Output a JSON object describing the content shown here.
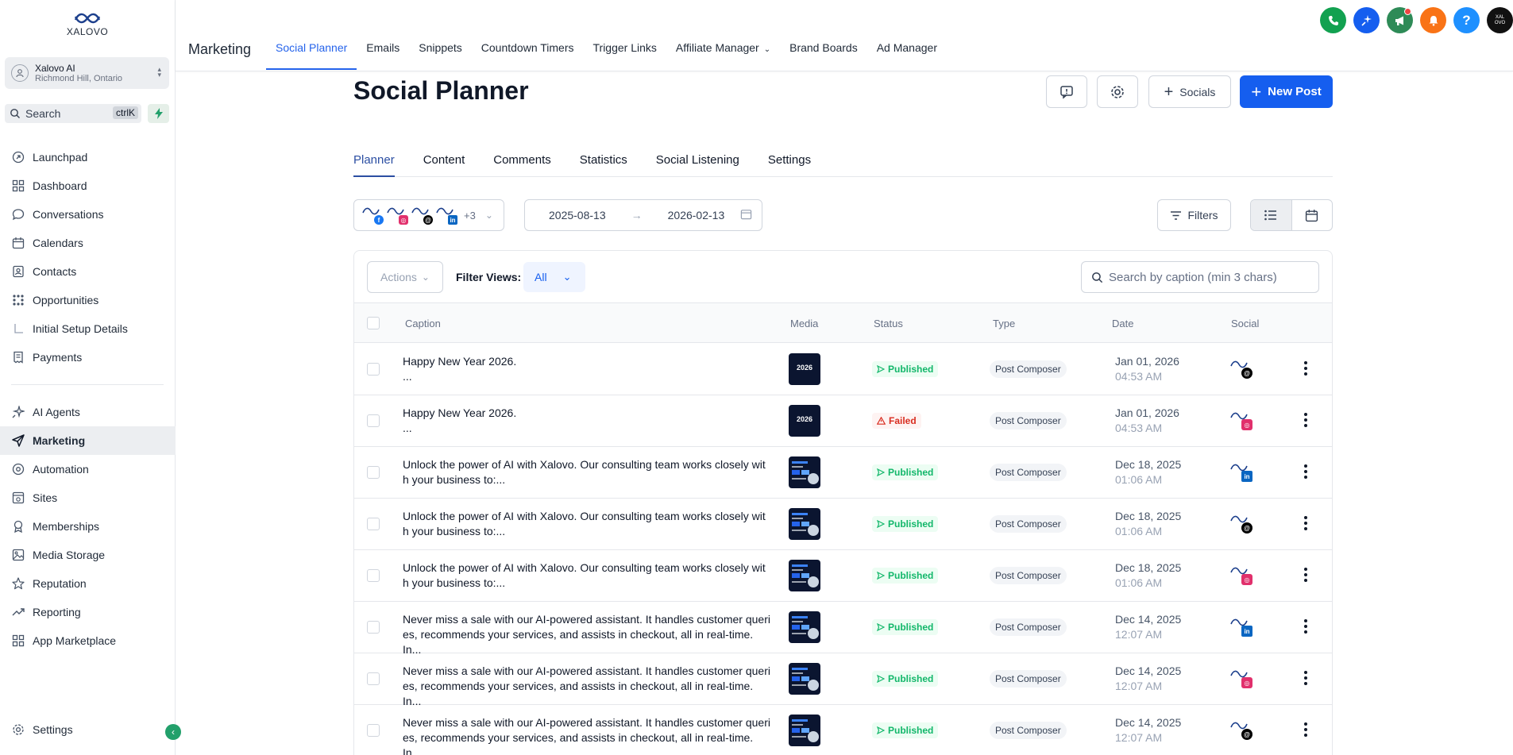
{
  "brand": {
    "logo_text": "XALOVO"
  },
  "account": {
    "name": "Xalovo AI",
    "location": "Richmond Hill, Ontario"
  },
  "search": {
    "label": "Search",
    "shortcut": "ctrlK"
  },
  "sidebar": {
    "items": [
      {
        "label": "Launchpad",
        "icon": "rocket-icon"
      },
      {
        "label": "Dashboard",
        "icon": "grid-icon"
      },
      {
        "label": "Conversations",
        "icon": "chat-icon"
      },
      {
        "label": "Calendars",
        "icon": "calendar-icon"
      },
      {
        "label": "Contacts",
        "icon": "contacts-icon"
      },
      {
        "label": "Opportunities",
        "icon": "funnel-icon"
      },
      {
        "label": "Initial Setup Details",
        "icon": "setup-icon"
      },
      {
        "label": "Payments",
        "icon": "receipt-icon"
      },
      {
        "label": "AI Agents",
        "icon": "sparkle-icon"
      },
      {
        "label": "Marketing",
        "icon": "send-icon"
      },
      {
        "label": "Automation",
        "icon": "automation-icon"
      },
      {
        "label": "Sites",
        "icon": "sites-icon"
      },
      {
        "label": "Memberships",
        "icon": "badge-icon"
      },
      {
        "label": "Media Storage",
        "icon": "image-icon"
      },
      {
        "label": "Reputation",
        "icon": "star-icon"
      },
      {
        "label": "Reporting",
        "icon": "trend-icon"
      },
      {
        "label": "App Marketplace",
        "icon": "apps-icon"
      }
    ],
    "settings_label": "Settings"
  },
  "topnav": {
    "title": "Marketing",
    "tabs": [
      "Social Planner",
      "Emails",
      "Snippets",
      "Countdown Timers",
      "Trigger Links",
      "Affiliate Manager",
      "Brand Boards",
      "Ad Manager"
    ]
  },
  "page": {
    "title": "Social Planner",
    "socials_label": "Socials",
    "new_post_label": "New Post",
    "subtabs": [
      "Planner",
      "Content",
      "Comments",
      "Statistics",
      "Social Listening",
      "Settings"
    ],
    "accounts_more": "+3",
    "date_from": "2025-08-13",
    "date_to": "2026-02-13",
    "filters_label": "Filters"
  },
  "table": {
    "actions_label": "Actions",
    "filter_views_label": "Filter Views:",
    "filter_views_value": "All",
    "search_placeholder": "Search by caption (min 3 chars)",
    "columns": [
      "Caption",
      "Media",
      "Status",
      "Type",
      "Date",
      "Social"
    ],
    "rows": [
      {
        "caption": "Happy New Year 2026.",
        "caption2": "...",
        "media": "2026",
        "status": "Published",
        "type": "Post Composer",
        "date": "Jan 01, 2026",
        "time": "04:53 AM",
        "social": "threads"
      },
      {
        "caption": "Happy New Year 2026.",
        "caption2": "...",
        "media": "2026",
        "status": "Failed",
        "type": "Post Composer",
        "date": "Jan 01, 2026",
        "time": "04:53 AM",
        "social": "instagram"
      },
      {
        "caption": "Unlock the power of AI with Xalovo. Our consulting team works closely wit",
        "caption2": "h your business to:...",
        "media": "",
        "status": "Published",
        "type": "Post Composer",
        "date": "Dec 18, 2025",
        "time": "01:06 AM",
        "social": "linkedin"
      },
      {
        "caption": "Unlock the power of AI with Xalovo. Our consulting team works closely wit",
        "caption2": "h your business to:...",
        "media": "",
        "status": "Published",
        "type": "Post Composer",
        "date": "Dec 18, 2025",
        "time": "01:06 AM",
        "social": "threads"
      },
      {
        "caption": "Unlock the power of AI with Xalovo. Our consulting team works closely wit",
        "caption2": "h your business to:...",
        "media": "",
        "status": "Published",
        "type": "Post Composer",
        "date": "Dec 18, 2025",
        "time": "01:06 AM",
        "social": "instagram"
      },
      {
        "caption": "Never miss a sale with our AI-powered assistant. It handles customer queri",
        "caption2": "es, recommends your services, and assists in checkout, all in real-time. In...",
        "media": "",
        "status": "Published",
        "type": "Post Composer",
        "date": "Dec 14, 2025",
        "time": "12:07 AM",
        "social": "linkedin"
      },
      {
        "caption": "Never miss a sale with our AI-powered assistant. It handles customer queri",
        "caption2": "es, recommends your services, and assists in checkout, all in real-time. In...",
        "media": "",
        "status": "Published",
        "type": "Post Composer",
        "date": "Dec 14, 2025",
        "time": "12:07 AM",
        "social": "instagram"
      },
      {
        "caption": "Never miss a sale with our AI-powered assistant. It handles customer queri",
        "caption2": "es, recommends your services, and assists in checkout, all in real-time. In...",
        "media": "",
        "status": "Published",
        "type": "Post Composer",
        "date": "Dec 14, 2025",
        "time": "12:07 AM",
        "social": "threads"
      }
    ]
  },
  "colors": {
    "primary": "#155eef",
    "published": "#12b76a",
    "failed": "#d92d20",
    "facebook": "#1877f2",
    "instagram": "#e1306c",
    "linkedin": "#0a66c2",
    "threads": "#000000"
  }
}
